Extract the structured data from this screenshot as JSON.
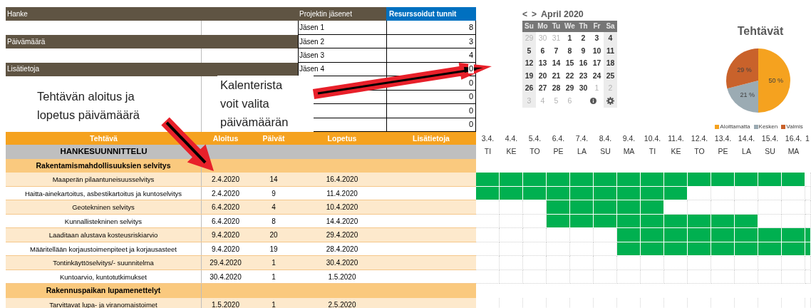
{
  "project_fields": [
    {
      "label": "Hanke"
    },
    {
      "label": "Päivämäärä"
    },
    {
      "label": "Lisätietoja"
    }
  ],
  "members_table": {
    "columns": [
      "Projektin jäsenet",
      "Resurssoidut tunnit"
    ],
    "rows": [
      {
        "name": "Jäsen 1",
        "hours": "8"
      },
      {
        "name": "Jäsen 2",
        "hours": "3"
      },
      {
        "name": "Jäsen 3",
        "hours": "4"
      },
      {
        "name": "Jäsen 4",
        "hours": "0"
      },
      {
        "hours": "0"
      },
      {
        "hours": "0"
      },
      {
        "hours": "0"
      },
      {
        "hours": "0"
      }
    ]
  },
  "notes": [
    "Tehtävän aloitus ja lopetus päivämäärä",
    "Kalenterista voit valita päivämäärän"
  ],
  "calendar": {
    "prev": "<",
    "next": ">",
    "month": "April 2020",
    "weekdays": [
      "Su",
      "Mo",
      "Tu",
      "We",
      "Th",
      "Fr",
      "Sa"
    ],
    "weeks": [
      [
        {
          "day": "29",
          "muted": true
        },
        {
          "day": "30",
          "muted": true
        },
        {
          "day": "31",
          "muted": true
        },
        {
          "day": "1",
          "muted": false
        },
        {
          "day": "2",
          "muted": false
        },
        {
          "day": "3",
          "muted": false
        },
        {
          "day": "4",
          "muted": false
        }
      ],
      [
        {
          "day": "5",
          "muted": false
        },
        {
          "day": "6",
          "muted": false
        },
        {
          "day": "7",
          "muted": false
        },
        {
          "day": "8",
          "muted": false
        },
        {
          "day": "9",
          "muted": false
        },
        {
          "day": "10",
          "muted": false
        },
        {
          "day": "11",
          "muted": false
        }
      ],
      [
        {
          "day": "12",
          "muted": false
        },
        {
          "day": "13",
          "muted": false
        },
        {
          "day": "14",
          "muted": false
        },
        {
          "day": "15",
          "muted": false
        },
        {
          "day": "16",
          "muted": false
        },
        {
          "day": "17",
          "muted": false
        },
        {
          "day": "18",
          "muted": false
        }
      ],
      [
        {
          "day": "19",
          "muted": false
        },
        {
          "day": "20",
          "muted": false
        },
        {
          "day": "21",
          "muted": false
        },
        {
          "day": "22",
          "muted": false
        },
        {
          "day": "23",
          "muted": false
        },
        {
          "day": "24",
          "muted": false
        },
        {
          "day": "25",
          "muted": false
        }
      ],
      [
        {
          "day": "26",
          "muted": false
        },
        {
          "day": "27",
          "muted": false
        },
        {
          "day": "28",
          "muted": false
        },
        {
          "day": "29",
          "muted": false
        },
        {
          "day": "30",
          "muted": false
        },
        {
          "day": "1",
          "muted": true
        },
        {
          "day": "2",
          "muted": true
        }
      ],
      [
        {
          "day": "3",
          "muted": true
        },
        {
          "day": "4",
          "muted": true
        },
        {
          "day": "5",
          "muted": true
        },
        {
          "day": "6",
          "muted": true
        }
      ]
    ]
  },
  "chart": {
    "legend": [
      {
        "color": "#f5a21f"
      },
      {
        "color": "#9babb3"
      },
      {
        "color": "#c9622b"
      }
    ],
    "chart_data": {
      "type": "pie",
      "title": "Tehtävät",
      "categories": [
        "Aloittamatta",
        "Kesken",
        "Valmis"
      ],
      "values": [
        50,
        21,
        29
      ],
      "value_labels": [
        "50 %",
        "21 %",
        "29 %"
      ]
    }
  },
  "task_table": {
    "columns": [
      "Tehtävä",
      "Aloitus",
      "Päivät",
      "Lopetus",
      "Lisätietoja"
    ],
    "days": [
      {
        "date": "3.4.",
        "weekday": "TI"
      },
      {
        "date": "4.4.",
        "weekday": "KE"
      },
      {
        "date": "5.4.",
        "weekday": "TO"
      },
      {
        "date": "6.4.",
        "weekday": "PE"
      },
      {
        "date": "7.4.",
        "weekday": "LA"
      },
      {
        "date": "8.4.",
        "weekday": "SU"
      },
      {
        "date": "9.4.",
        "weekday": "MA"
      },
      {
        "date": "10.4.",
        "weekday": "TI"
      },
      {
        "date": "11.4.",
        "weekday": "KE"
      },
      {
        "date": "12.4.",
        "weekday": "TO"
      },
      {
        "date": "13.4.",
        "weekday": "PE"
      },
      {
        "date": "14.4.",
        "weekday": "LA"
      },
      {
        "date": "15.4.",
        "weekday": "SU"
      },
      {
        "date": "16.4.",
        "weekday": "MA"
      },
      {
        "date": "1"
      }
    ],
    "rows": [
      {
        "kind": "phase",
        "name": "HANKESUUNNITTELU"
      },
      {
        "kind": "section",
        "name": "Rakentamismahdollisuuksien selvitys"
      },
      {
        "kind": "task",
        "name": "Maaperän pilaantuneisuusselvitys",
        "start": "2.4.2020",
        "days": "14",
        "end": "16.4.2020",
        "gantt": [
          true,
          true,
          true,
          true,
          true,
          true,
          true,
          true,
          true,
          true,
          true,
          true,
          true,
          true,
          false
        ]
      },
      {
        "kind": "task",
        "name": "Haitta-ainekartoitus, asbestikartoitus ja kuntoselvitys",
        "start": "2.4.2020",
        "days": "9",
        "end": "11.4.2020",
        "gantt": [
          true,
          true,
          true,
          true,
          true,
          true,
          true,
          true,
          true,
          false,
          false,
          false,
          false,
          false,
          false
        ]
      },
      {
        "kind": "task",
        "name": "Geotekninen selvitys",
        "start": "6.4.2020",
        "days": "4",
        "end": "10.4.2020",
        "gantt": [
          false,
          false,
          false,
          true,
          true,
          true,
          true,
          true,
          false,
          false,
          false,
          false,
          false,
          false,
          false
        ]
      },
      {
        "kind": "task",
        "name": "Kunnallistekninen selvitys",
        "start": "6.4.2020",
        "days": "8",
        "end": "14.4.2020",
        "gantt": [
          false,
          false,
          false,
          true,
          true,
          true,
          true,
          true,
          true,
          true,
          true,
          true,
          false,
          false,
          false
        ]
      },
      {
        "kind": "task",
        "name": "Laaditaan alustava kosteusriskiarvio",
        "start": "9.4.2020",
        "days": "20",
        "end": "29.4.2020",
        "gantt": [
          false,
          false,
          false,
          false,
          false,
          false,
          true,
          true,
          true,
          true,
          true,
          true,
          true,
          true,
          true
        ]
      },
      {
        "kind": "task",
        "name": "Määritellään korjaustoimenpiteet ja korjausasteet",
        "start": "9.4.2020",
        "days": "19",
        "end": "28.4.2020",
        "gantt": [
          false,
          false,
          false,
          false,
          false,
          false,
          true,
          true,
          true,
          true,
          true,
          true,
          true,
          true,
          true
        ]
      },
      {
        "kind": "task",
        "name": "Tontinkäyttöselvitys/- suunnitelma",
        "start": "29.4.2020",
        "days": "1",
        "end": "30.4.2020",
        "gantt": [
          false,
          false,
          false,
          false,
          false,
          false,
          false,
          false,
          false,
          false,
          false,
          false,
          false,
          false,
          false
        ]
      },
      {
        "kind": "task",
        "name": "Kuntoarvio, kuntotutkimukset",
        "start": "30.4.2020",
        "days": "1",
        "end": "1.5.2020",
        "gantt": [
          false,
          false,
          false,
          false,
          false,
          false,
          false,
          false,
          false,
          false,
          false,
          false,
          false,
          false,
          false
        ]
      },
      {
        "kind": "section",
        "name": "Rakennuspaikan lupamenettelyt"
      },
      {
        "kind": "task",
        "name": "Tarvittavat lupa- ja viranomaistoimet",
        "start": "1.5.2020",
        "days": "1",
        "end": "2.5.2020",
        "gantt": [
          false,
          false,
          false,
          false,
          false,
          false,
          false,
          false,
          false,
          false,
          false,
          false,
          false,
          false,
          false
        ]
      }
    ]
  }
}
